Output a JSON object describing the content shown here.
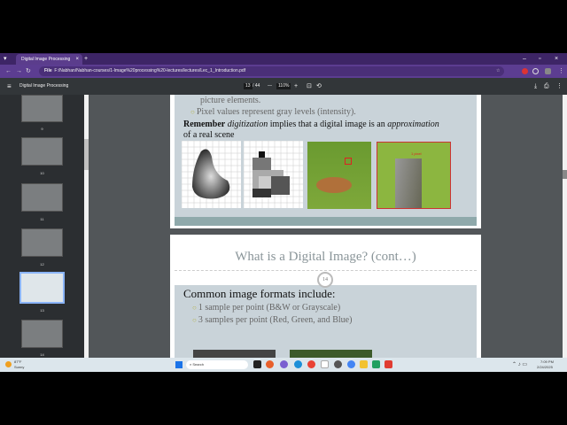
{
  "browser": {
    "tab_title": "Digital Image Processing",
    "address_prefix": "File",
    "url": "F:/Nabhan/Nabhan-courses/1-Image%20processing%20-lectures/lectures/Lec_1_Introduction.pdf"
  },
  "pdf_toolbar": {
    "title": "Digital Image Processing",
    "page_current": "13",
    "page_total": "/ 44",
    "zoom": "110%"
  },
  "thumbnails": [
    {
      "label": "9"
    },
    {
      "label": "10"
    },
    {
      "label": "11"
    },
    {
      "label": "12"
    },
    {
      "label": "13",
      "selected": true
    },
    {
      "label": "14"
    }
  ],
  "slide13": {
    "bullet_partial": "picture elements.",
    "bullet": "Pixel values represent gray levels (intensity).",
    "remember_bold": "Remember",
    "remember_italic1": "digitization",
    "remember_mid": " implies that a digital image is an ",
    "remember_italic2": "approximation",
    "remember_end": "of a real scene",
    "pixel_label": "1 pixel"
  },
  "slide14": {
    "title": "What is a Digital Image? (cont…)",
    "number": "14",
    "heading": "Common image formats include:",
    "bullets": [
      "1 sample per point (B&W or Grayscale)",
      "3 samples per point (Red, Green, and Blue)"
    ]
  },
  "taskbar": {
    "weather_temp": "87°F",
    "weather_desc": "Sunny",
    "search_placeholder": "Search",
    "time": "7:09 PM",
    "date": "2/24/2025"
  },
  "colors": {
    "accent": "#5c3d91",
    "slide_bg": "#c9d3d9",
    "slide_band": "#8fa9ab",
    "bullet": "#b6b34a"
  }
}
